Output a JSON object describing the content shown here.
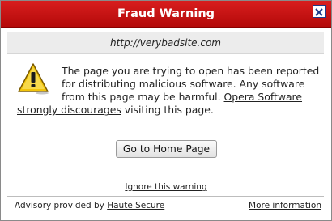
{
  "dialog": {
    "title": "Fraud Warning",
    "url": "http://verybadsite.com",
    "message_text": "The page you are trying to open has been reported for distributing malicious software. Any software from this page may be harmful.",
    "message_link": "Opera Software strongly discourages",
    "message_tail": "visiting this page.",
    "home_button_label": "Go to Home Page",
    "ignore_link": "Ignore this warning",
    "footer_prefix": "Advisory provided by",
    "footer_provider_link": "Haute Secure",
    "more_info_link": "More information",
    "icons": {
      "close": "close-icon",
      "warning": "warning-icon"
    },
    "colors": {
      "titlebar": "#c81414",
      "url_bar": "#ececec",
      "warning_yellow": "#f2c40a"
    }
  }
}
